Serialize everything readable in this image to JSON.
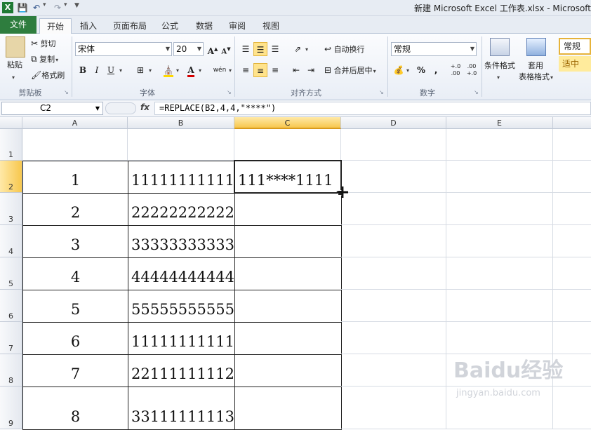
{
  "window": {
    "title": "新建 Microsoft Excel 工作表.xlsx - Microsoft Excel"
  },
  "quick_access": {
    "icons": [
      "excel-logo-icon",
      "save-icon",
      "undo-icon",
      "redo-icon",
      "customize-icon"
    ]
  },
  "tabs": [
    {
      "label": "文件"
    },
    {
      "label": "开始"
    },
    {
      "label": "插入"
    },
    {
      "label": "页面布局"
    },
    {
      "label": "公式"
    },
    {
      "label": "数据"
    },
    {
      "label": "审阅"
    },
    {
      "label": "视图"
    }
  ],
  "ribbon": {
    "clipboard": {
      "group_label": "剪贴板",
      "paste": "粘贴",
      "cut": "剪切",
      "copy": "复制",
      "format_painter": "格式刷"
    },
    "font": {
      "group_label": "字体",
      "font_name": "宋体",
      "font_size": "20",
      "grow": "A",
      "shrink": "A",
      "bold": "B",
      "italic": "I",
      "underline": "U",
      "font_color_letter": "A",
      "phonetic": "wén"
    },
    "alignment": {
      "group_label": "对齐方式",
      "wrap_text": "自动换行",
      "merge_center": "合并后居中"
    },
    "number": {
      "group_label": "数字",
      "format": "常规",
      "percent": "%",
      "comma": ",",
      "inc_decimal": "+.0 .00",
      "dec_decimal": ".00 +.0"
    },
    "styles": {
      "conditional_format": "条件格式",
      "table_format_line1": "套用",
      "table_format_line2": "表格格式",
      "style_normal": "常规",
      "style_neutral": "适中"
    },
    "colors": {
      "file_tab": "#2e7d3e",
      "active_button": "#ffe38b",
      "neutral_style": "#ffeb9c"
    }
  },
  "formula_bar": {
    "name_box": "C2",
    "fx": "fx",
    "formula": "=REPLACE(B2,4,4,\"****\")"
  },
  "columns": [
    "A",
    "B",
    "C",
    "D",
    "E"
  ],
  "rows": [
    {
      "num": "1",
      "a": "",
      "b": "",
      "c": ""
    },
    {
      "num": "2",
      "a": "1",
      "b": "11111111111",
      "c": "111****1111"
    },
    {
      "num": "3",
      "a": "2",
      "b": "22222222222",
      "c": ""
    },
    {
      "num": "4",
      "a": "3",
      "b": "33333333333",
      "c": ""
    },
    {
      "num": "5",
      "a": "4",
      "b": "44444444444",
      "c": ""
    },
    {
      "num": "6",
      "a": "5",
      "b": "55555555555",
      "c": ""
    },
    {
      "num": "7",
      "a": "6",
      "b": "11111111111",
      "c": ""
    },
    {
      "num": "8",
      "a": "7",
      "b": "22111111112",
      "c": ""
    },
    {
      "num": "9",
      "a": "8",
      "b": "33111111113",
      "c": ""
    }
  ],
  "selection": {
    "active_cell": "C2",
    "cursor": "+"
  },
  "watermark": {
    "logo": "Baidu经验",
    "site": "jingyan.baidu.com"
  }
}
